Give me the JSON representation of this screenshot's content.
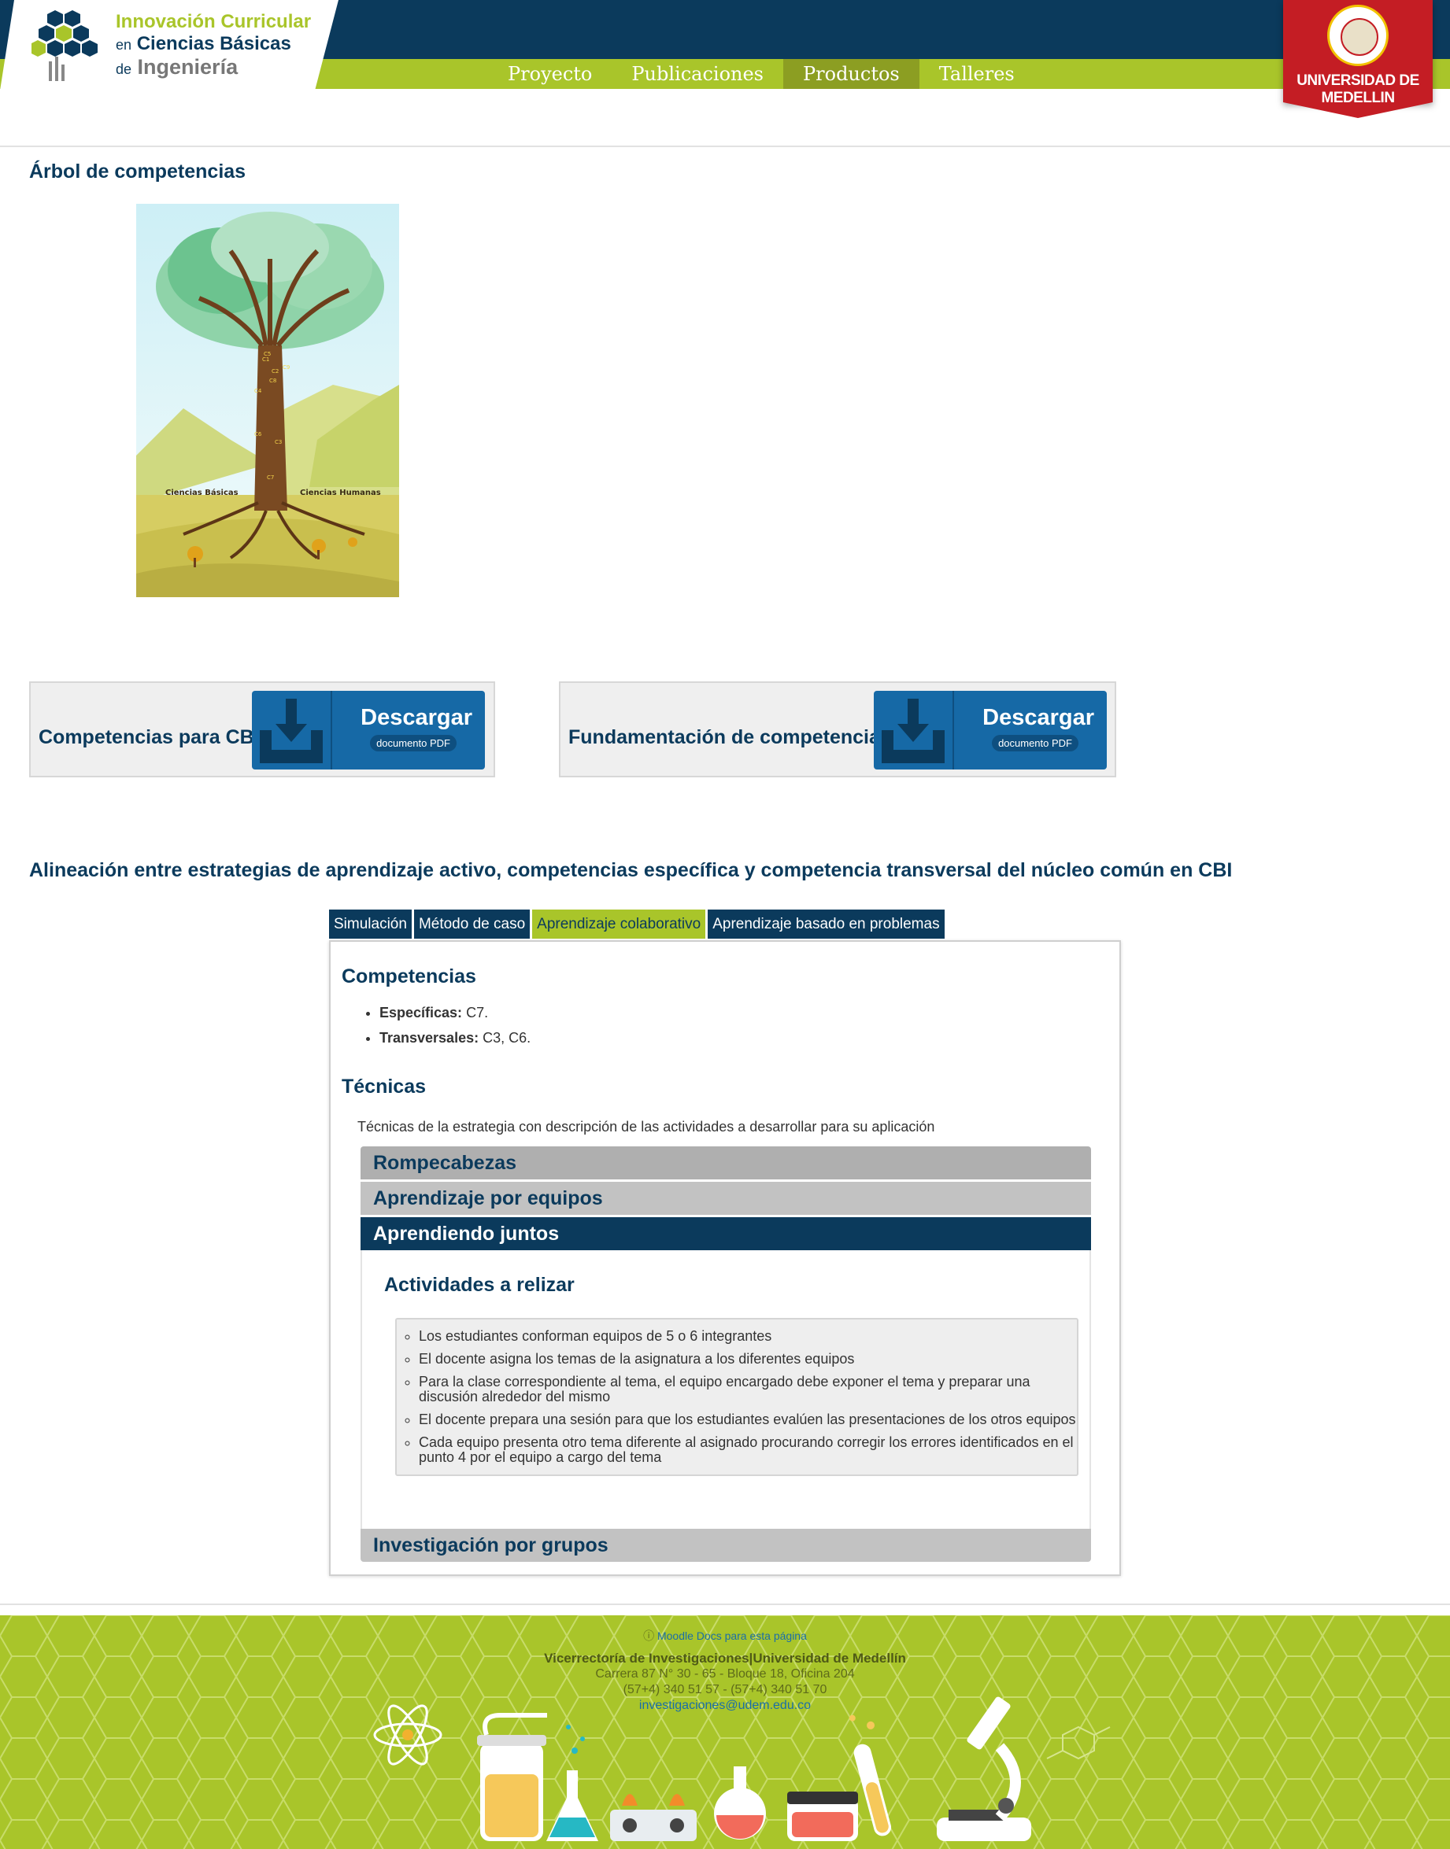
{
  "brand": {
    "line1": "Innovación Curricular",
    "line2_prefix": "en",
    "line2": "Ciencias Básicas",
    "line3_prefix": "de",
    "line3": "Ingeniería"
  },
  "nav": [
    {
      "label": "Proyecto"
    },
    {
      "label": "Publicaciones"
    },
    {
      "label": "Productos"
    },
    {
      "label": "Talleres"
    }
  ],
  "university": {
    "name": "UNIVERSIDAD DE MEDELLIN"
  },
  "tree_section": {
    "title": "Árbol de competencias",
    "labels": {
      "left": "Ciencias Básicas",
      "right": "Ciencias Humanas"
    },
    "competencies": [
      "C1",
      "C2",
      "C3",
      "C4",
      "C5",
      "C6",
      "C7",
      "C8",
      "C9"
    ]
  },
  "downloads": [
    {
      "label": "Competencias para CBI",
      "button": "Descargar",
      "sub": "documento PDF"
    },
    {
      "label": "Fundamentación de competencias",
      "button": "Descargar",
      "sub": "documento PDF"
    }
  ],
  "alignment": {
    "title": "Alineación entre estrategias de aprendizaje activo, competencias específica y competencia transversal del núcleo común en CBI",
    "tabs": [
      {
        "label": "Simulación"
      },
      {
        "label": "Método de caso"
      },
      {
        "label": "Aprendizaje colaborativo"
      },
      {
        "label": "Aprendizaje basado en problemas"
      }
    ],
    "active_tab": "Aprendizaje colaborativo",
    "competencias_title": "Competencias",
    "especificas_label": "Específicas:",
    "especificas_value": "C7.",
    "transversales_label": "Transversales:",
    "transversales_value": "C3, C6.",
    "tecnicas_title": "Técnicas",
    "tecnicas_text": "Técnicas de la estrategia con descripción de las actividades a desarrollar para su aplicación",
    "accordion": [
      {
        "label": "Rompecabezas"
      },
      {
        "label": "Aprendizaje por equipos"
      },
      {
        "label": "Aprendiendo juntos"
      },
      {
        "label": "Investigación por grupos"
      }
    ],
    "open_section": {
      "title": "Actividades a relizar",
      "items": [
        "Los estudiantes conforman equipos de 5 o 6 integrantes",
        "El docente asigna los temas de la asignatura a los diferentes equipos",
        "Para la clase correspondiente al tema, el equipo encargado debe exponer el tema y preparar una discusión alrededor del mismo",
        "El docente prepara una sesión para que los estudiantes evalúen las presentaciones de los otros equipos",
        "Cada equipo presenta otro tema diferente al asignado procurando corregir los errores identificados en el punto 4 por el equipo a cargo del tema"
      ]
    }
  },
  "footer": {
    "docs_link": "Moodle Docs para esta página",
    "org": "Vicerrectoría de Investigaciones|Universidad de Medellín",
    "address": "Carrera 87 N° 30 - 65 - Bloque 18, Oficina 204",
    "phones": "(57+4) 340 51 57 - (57+4) 340 51 70",
    "email": "investigaciones@udem.edu.co"
  },
  "colors": {
    "navy": "#0b3a5c",
    "lime": "#a9c52a",
    "red": "#c41d24",
    "download_blue": "#1669a6"
  }
}
